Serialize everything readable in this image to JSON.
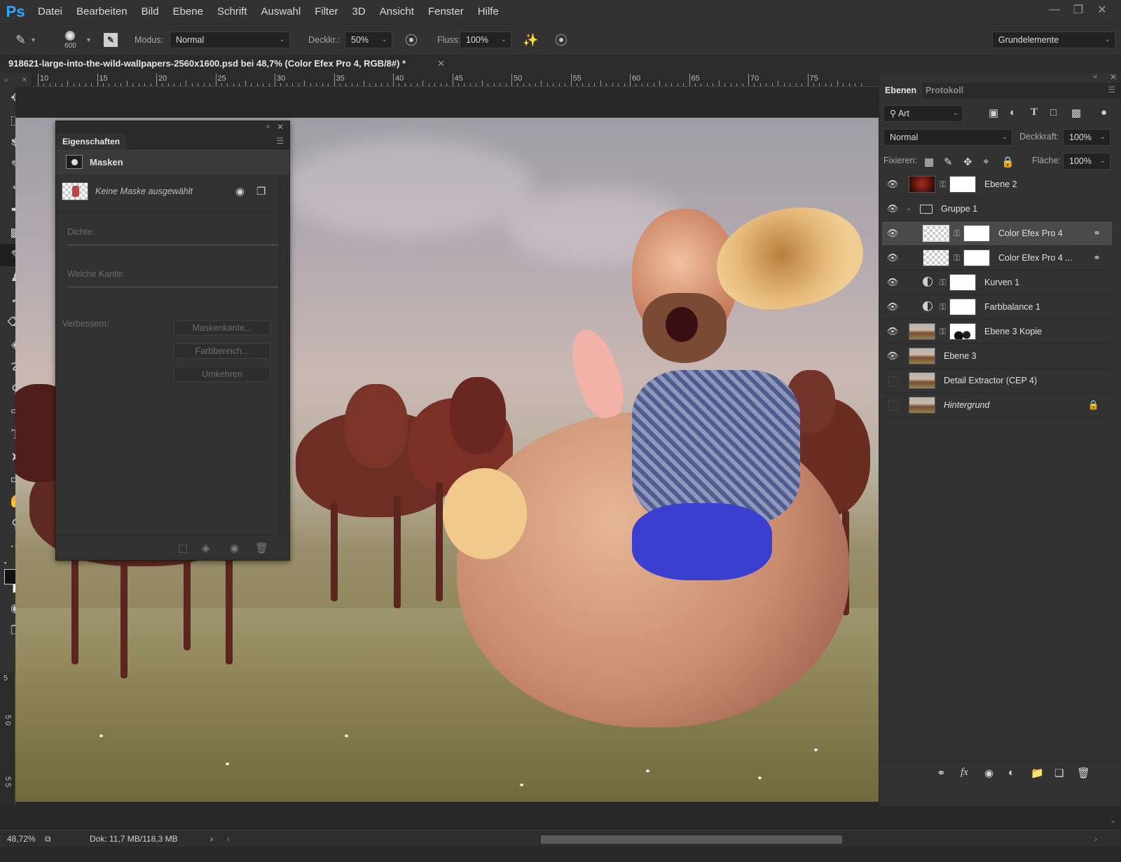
{
  "app": {
    "logo": "Ps"
  },
  "menu": [
    "Datei",
    "Bearbeiten",
    "Bild",
    "Ebene",
    "Schrift",
    "Auswahl",
    "Filter",
    "3D",
    "Ansicht",
    "Fenster",
    "Hilfe"
  ],
  "options": {
    "brush_size": "600",
    "modus_label": "Modus:",
    "modus_value": "Normal",
    "deckkr_label": "Deckkr.:",
    "deckkr_value": "50%",
    "fluss_label": "Fluss:",
    "fluss_value": "100%",
    "workspace": "Grundelemente"
  },
  "document": {
    "tab_title": "918621-large-into-the-wild-wallpapers-2560x1600.psd bei 48,7% (Color Efex Pro 4, RGB/8#) *"
  },
  "ruler_top": [
    "10",
    "15",
    "20",
    "25",
    "30",
    "35",
    "40",
    "45",
    "50",
    "55",
    "60",
    "65",
    "70",
    "75"
  ],
  "ruler_left": [
    "5",
    "5 0",
    "5 5"
  ],
  "properties": {
    "title": "Eigenschaften",
    "section": "Masken",
    "no_mask": "Keine Maske ausgewählt",
    "dichte_label": "Dichte:",
    "weiche_kante_label": "Weiche Kante:",
    "verbessern_label": "Verbessern:",
    "btn_maskenkante": "Maskenkante...",
    "btn_farbbereich": "Farbbereich...",
    "btn_umkehren": "Umkehren"
  },
  "layers_panel": {
    "tab_ebenen": "Ebenen",
    "tab_protokoll": "Protokoll",
    "filter_kind": "Art",
    "blend_mode": "Normal",
    "deckkraft_label": "Deckkraft:",
    "deckkraft_value": "100%",
    "fixieren_label": "Fixieren:",
    "flaeche_label": "Fläche:",
    "flaeche_value": "100%",
    "layers": [
      {
        "name": "Ebene 2",
        "visible": true
      },
      {
        "name": "Gruppe 1",
        "visible": true
      },
      {
        "name": "Color Efex Pro 4",
        "visible": true,
        "selected": true
      },
      {
        "name": "Color Efex Pro 4 ...",
        "visible": true
      },
      {
        "name": "Kurven 1",
        "visible": true
      },
      {
        "name": "Farbbalance 1",
        "visible": true
      },
      {
        "name": "Ebene 3 Kopie",
        "visible": true
      },
      {
        "name": "Ebene 3",
        "visible": true
      },
      {
        "name": "Detail Extractor (CEP 4)",
        "visible": false
      },
      {
        "name": "Hintergrund",
        "visible": false,
        "locked": true
      }
    ]
  },
  "status": {
    "zoom": "48,72%",
    "doc_info": "Dok: 11,7 MB/118,3 MB"
  },
  "colors": {
    "accent": "#31a8ff",
    "panel": "#323232",
    "background": "#282828"
  }
}
